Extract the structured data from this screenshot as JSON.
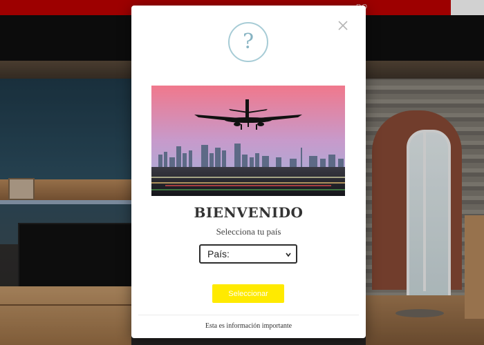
{
  "top_bar": {
    "text": "RO",
    "color": "#c00000"
  },
  "modal": {
    "icon": "question-circle-icon",
    "close_icon": "close-icon",
    "title": "BIENVENIDO",
    "subtitle": "Selecciona tu país",
    "country_select": {
      "selected": "País:"
    },
    "submit_label": "Seleccionar",
    "footer_note": "Esta es información importante",
    "accent_color": "#ffea00"
  }
}
